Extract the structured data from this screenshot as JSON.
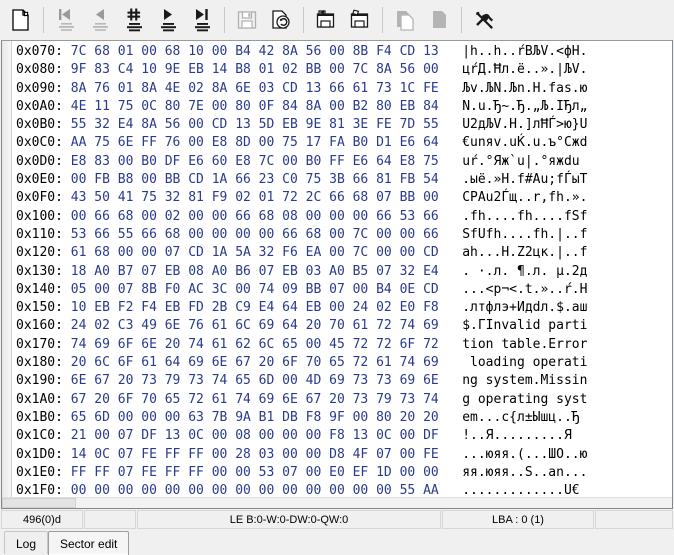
{
  "toolbar": {
    "groups": [
      {
        "buttons": [
          {
            "name": "new-document-icon",
            "label": "New"
          }
        ]
      },
      {
        "buttons": [
          {
            "name": "go-first-sector-icon",
            "label": "First sector"
          },
          {
            "name": "go-previous-sector-icon",
            "label": "Previous sector"
          },
          {
            "name": "goto-sector-number-icon",
            "label": "Go to sector"
          },
          {
            "name": "go-next-sector-icon",
            "label": "Next sector"
          },
          {
            "name": "go-last-sector-icon",
            "label": "Last sector"
          }
        ]
      },
      {
        "buttons": [
          {
            "name": "save-icon",
            "label": "Save"
          },
          {
            "name": "save-as-icon",
            "label": "Save as"
          }
        ]
      },
      {
        "buttons": [
          {
            "name": "load-from-disk-icon",
            "label": "Read sector from disk"
          },
          {
            "name": "write-to-disk-icon",
            "label": "Write sector to disk"
          }
        ]
      },
      {
        "buttons": [
          {
            "name": "copy-icon",
            "label": "Copy"
          },
          {
            "name": "paste-icon",
            "label": "Paste"
          }
        ]
      },
      {
        "buttons": [
          {
            "name": "tools-icon",
            "label": "Tools"
          }
        ]
      }
    ]
  },
  "hex_view": {
    "cursor": {
      "row": 31,
      "byte_index": 0,
      "nibble": 0
    },
    "rows": [
      {
        "offset": "0x070:",
        "bytes": "7C 68 01 00 68 10 00 B4 42 8A 56 00 8B F4 CD 13",
        "ascii": "|h..h..ŕBЉV.<фH."
      },
      {
        "offset": "0x080:",
        "bytes": "9F 83 C4 10 9E EB 14 B8 01 02 BB 00 7C 8A 56 00",
        "ascii": "цŕД.Ħл.ё..».|ЉV."
      },
      {
        "offset": "0x090:",
        "bytes": "8A 76 01 8A 4E 02 8A 6E 03 CD 13 66 61 73 1C FE",
        "ascii": "Љv.ЉN.Љn.H.fas.ю"
      },
      {
        "offset": "0x0A0:",
        "bytes": "4E 11 75 0C 80 7E 00 80 0F 84 8A 00 B2 80 EB 84",
        "ascii": "N.u.Ђ~.Ђ.„Љ.IЂл„"
      },
      {
        "offset": "0x0B0:",
        "bytes": "55 32 E4 8A 56 00 CD 13 5D EB 9E 81 3E FE 7D 55",
        "ascii": "U2дЉV.H.]лĦЃ>ю}U"
      },
      {
        "offset": "0x0C0:",
        "bytes": "AA 75 6E FF 76 00 E8 8D 00 75 17 FA B0 D1 E6 64",
        "ascii": "€unяv.uЌ.u.ъ°Сжd"
      },
      {
        "offset": "0x0D0:",
        "bytes": "E8 83 00 B0 DF E6 60 E8 7C 00 B0 FF E6 64 E8 75",
        "ascii": "uŕ.°Яж`u|.°яжdu"
      },
      {
        "offset": "0x0E0:",
        "bytes": "00 FB B8 00 BB CD 1A 66 23 C0 75 3B 66 81 FB 54",
        "ascii": ".ыё.»H.f#Au;fЃыT"
      },
      {
        "offset": "0x0F0:",
        "bytes": "43 50 41 75 32 81 F9 02 01 72 2C 66 68 07 BB 00",
        "ascii": "CPAu2Ѓщ..r,fh.»."
      },
      {
        "offset": "0x100:",
        "bytes": "00 66 68 00 02 00 00 66 68 08 00 00 00 66 53 66",
        "ascii": ".fh....fh....fSf"
      },
      {
        "offset": "0x110:",
        "bytes": "53 66 55 66 68 00 00 00 00 66 68 00 7C 00 00 66",
        "ascii": "SfUfh....fh.|..f"
      },
      {
        "offset": "0x120:",
        "bytes": "61 68 00 00 07 CD 1A 5A 32 F6 EA 00 7C 00 00 CD",
        "ascii": "ah...H.Z2цк.|..f"
      },
      {
        "offset": "0x130:",
        "bytes": "18 A0 B7 07 EB 08 A0 B6 07 EB 03 A0 B5 07 32 E4",
        "ascii": ". ·.л. ¶.л. μ.2д"
      },
      {
        "offset": "0x140:",
        "bytes": "05 00 07 8B F0 AC 3C 00 74 09 BB 07 00 B4 0E CD",
        "ascii": "...<p¬<.t.»..ŕ.H"
      },
      {
        "offset": "0x150:",
        "bytes": "10 EB F2 F4 EB FD 2B C9 E4 64 EB 00 24 02 E0 F8",
        "ascii": ".лтфлэ+Идdл.$.аш"
      },
      {
        "offset": "0x160:",
        "bytes": "24 02 C3 49 6E 76 61 6C 69 64 20 70 61 72 74 69",
        "ascii": "$.ГInvalid parti"
      },
      {
        "offset": "0x170:",
        "bytes": "74 69 6F 6E 20 74 61 62 6C 65 00 45 72 72 6F 72",
        "ascii": "tion table.Error"
      },
      {
        "offset": "0x180:",
        "bytes": "20 6C 6F 61 64 69 6E 67 20 6F 70 65 72 61 74 69",
        "ascii": " loading operati"
      },
      {
        "offset": "0x190:",
        "bytes": "6E 67 20 73 79 73 74 65 6D 00 4D 69 73 73 69 6E",
        "ascii": "ng system.Missin"
      },
      {
        "offset": "0x1A0:",
        "bytes": "67 20 6F 70 65 72 61 74 69 6E 67 20 73 79 73 74",
        "ascii": "g operating syst"
      },
      {
        "offset": "0x1B0:",
        "bytes": "65 6D 00 00 00 63 7B 9A B1 DB F8 9F 00 80 20 20",
        "ascii": "em...c{л±Ышц..Ђ "
      },
      {
        "offset": "0x1C0:",
        "bytes": "21 00 07 DF 13 0C 00 08 00 00 00 F8 13 0C 00 DF",
        "ascii": "!..Я.........Я"
      },
      {
        "offset": "0x1D0:",
        "bytes": "14 0C 07 FE FF FF 00 28 03 00 00 D8 4F 07 00 FE",
        "ascii": "...юяя.(...ШO..ю"
      },
      {
        "offset": "0x1E0:",
        "bytes": "FF FF 07 FE FF FF 00 00 53 07 00 E0 EF 1D 00 00",
        "ascii": "яя.юяя..S..an..."
      },
      {
        "offset": "0x1F0:",
        "bytes": "00 00 00 00 00 00 00 00 00 00 00 00 00 00 55 AA",
        "ascii": ".............U€"
      }
    ]
  },
  "status_bar": {
    "offset_decimal": "496(0)d",
    "blank": "",
    "endian_values": "LE B:0-W:0-DW:0-QW:0",
    "lba": "LBA : 0 (1)",
    "extra": ""
  },
  "tabs": [
    {
      "label": "Log",
      "active": false
    },
    {
      "label": "Sector edit",
      "active": true
    }
  ],
  "colors": {
    "hex_byte_text": "#2a3a8c",
    "cursor_background": "#000080",
    "cursor_text": "#ffffff",
    "window_background": "#f0f0f0",
    "pane_background": "#ffffff"
  }
}
